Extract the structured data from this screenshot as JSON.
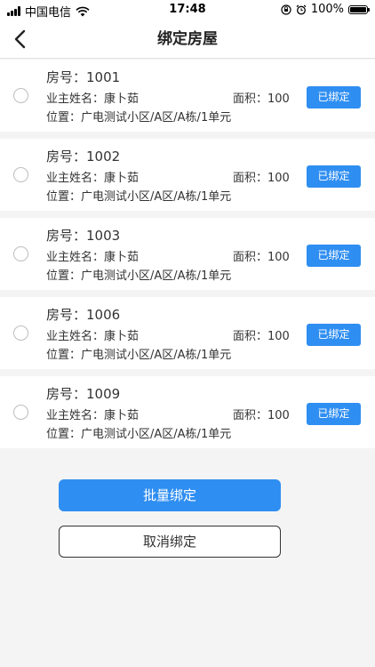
{
  "status": {
    "carrier": "中国电信",
    "time": "17:48",
    "battery": "100%",
    "battery_level": 1.0,
    "icons": [
      "signal-icon",
      "wifi-icon",
      "rotation-lock-icon",
      "alarm-icon",
      "battery-icon"
    ]
  },
  "nav": {
    "title": "绑定房屋",
    "back_icon": "chevron-left-icon"
  },
  "labels": {
    "room": "房号：",
    "owner": "业主姓名：",
    "area": "面积：",
    "location": "位置："
  },
  "houses": [
    {
      "room": "1001",
      "owner": "康卜茹",
      "area": "100",
      "location": "广电测试小区/A区/A栋/1单元",
      "status": "已绑定"
    },
    {
      "room": "1002",
      "owner": "康卜茹",
      "area": "100",
      "location": "广电测试小区/A区/A栋/1单元",
      "status": "已绑定"
    },
    {
      "room": "1003",
      "owner": "康卜茹",
      "area": "100",
      "location": "广电测试小区/A区/A栋/1单元",
      "status": "已绑定"
    },
    {
      "room": "1006",
      "owner": "康卜茹",
      "area": "100",
      "location": "广电测试小区/A区/A栋/1单元",
      "status": "已绑定"
    },
    {
      "room": "1009",
      "owner": "康卜茹",
      "area": "100",
      "location": "广电测试小区/A区/A栋/1单元",
      "status": "已绑定"
    }
  ],
  "actions": {
    "batch_bind": "批量绑定",
    "cancel_bind": "取消绑定"
  },
  "colors": {
    "accent": "#2f8ef1",
    "background": "#f4f4f4"
  }
}
